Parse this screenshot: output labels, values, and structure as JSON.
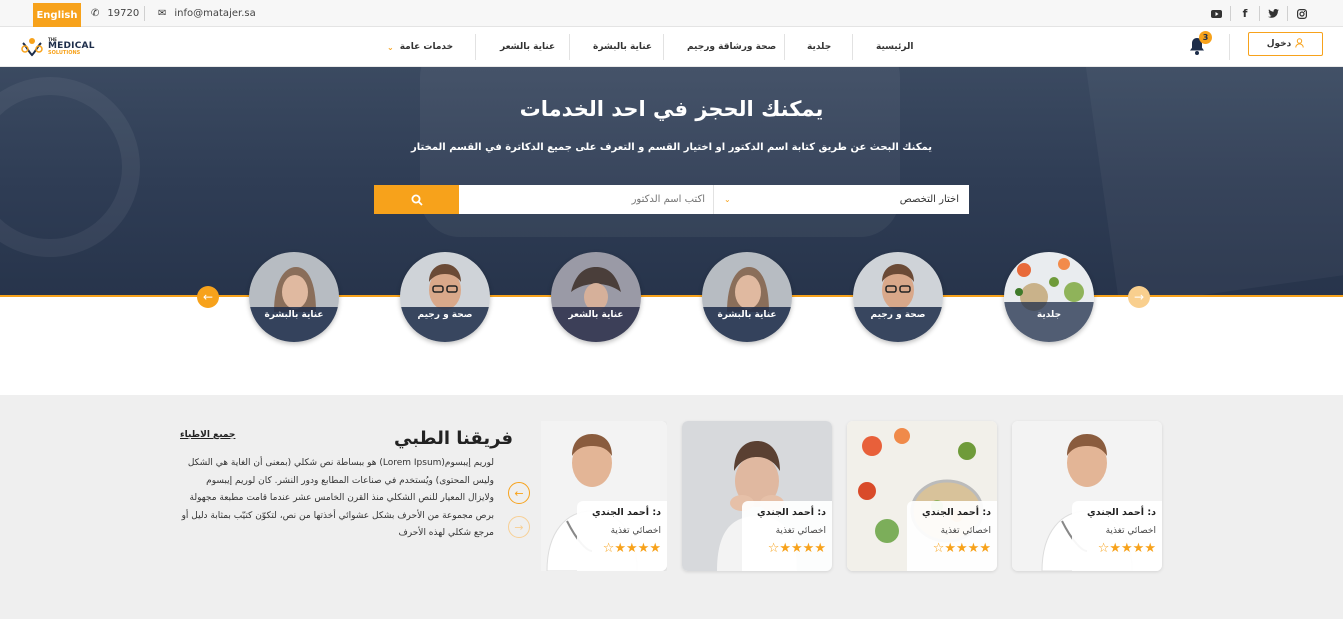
{
  "topbar": {
    "lang_button": "English",
    "phone": "19720",
    "email": "info@matajer.sa",
    "social_icons": [
      "youtube-icon",
      "facebook-icon",
      "twitter-icon",
      "instagram-icon"
    ]
  },
  "logo": {
    "line1": "THE",
    "line2": "MEDICAL",
    "line3": "SOLUTIONS"
  },
  "nav": {
    "items": [
      "الرئيسية",
      "جلدية",
      "صحة ورشاقة ورجيم",
      "عناية بالبشرة",
      "عناية بالشعر",
      "خدمات عامة"
    ],
    "notification_count": "3",
    "login_label": "دخول"
  },
  "hero": {
    "title": "يمكنك الحجز في احد الخدمات",
    "subtitle": "يمكنك البحث عن طريق كتابة اسم الدكتور او اختيار القسم و التعرف على جميع الدكاترة في القسم المختار",
    "search_placeholder": "أكتب اسم الدكتور",
    "specialty_select": "اختار التخصص"
  },
  "categories": [
    "جلدية",
    "صحة و رجيم",
    "عناية بالبشرة",
    "عناية بالشعر",
    "صحة و رجيم",
    "عناية بالبشرة"
  ],
  "team": {
    "title": "فريقنا الطبي",
    "all_link": "جميع الاطباء",
    "description": "لوريم إيبسوم(Lorem Ipsum) هو ببساطة نص شكلي (بمعنى أن الغاية هي الشكل وليس المحتوى) ويُستخدم في صناعات المطابع ودور النشر. كان لوريم إيبسوم ولايزال المعيار للنص الشكلي منذ القرن الخامس عشر عندما قامت مطبعة مجهولة برص مجموعة من الأحرف بشكل عشوائي أخذتها من نص، لتكوّن كتيّب بمثابة دليل أو مرجع شكلي لهذه الأحرف",
    "cards": [
      {
        "name": "د: أحمد الجندي",
        "specialty": "اخصائي تغذية",
        "rating": 4
      },
      {
        "name": "د: أحمد الجندي",
        "specialty": "اخصائي تغذية",
        "rating": 4
      },
      {
        "name": "د: أحمد الجندي",
        "specialty": "اخصائي تغذية",
        "rating": 4
      },
      {
        "name": "د: أحمد الجندي",
        "specialty": "اخصائي تغذية",
        "rating": 4
      }
    ]
  },
  "colors": {
    "accent": "#f7a21b",
    "hero_bg": "#2f3d55",
    "team_bg": "#efefef"
  }
}
